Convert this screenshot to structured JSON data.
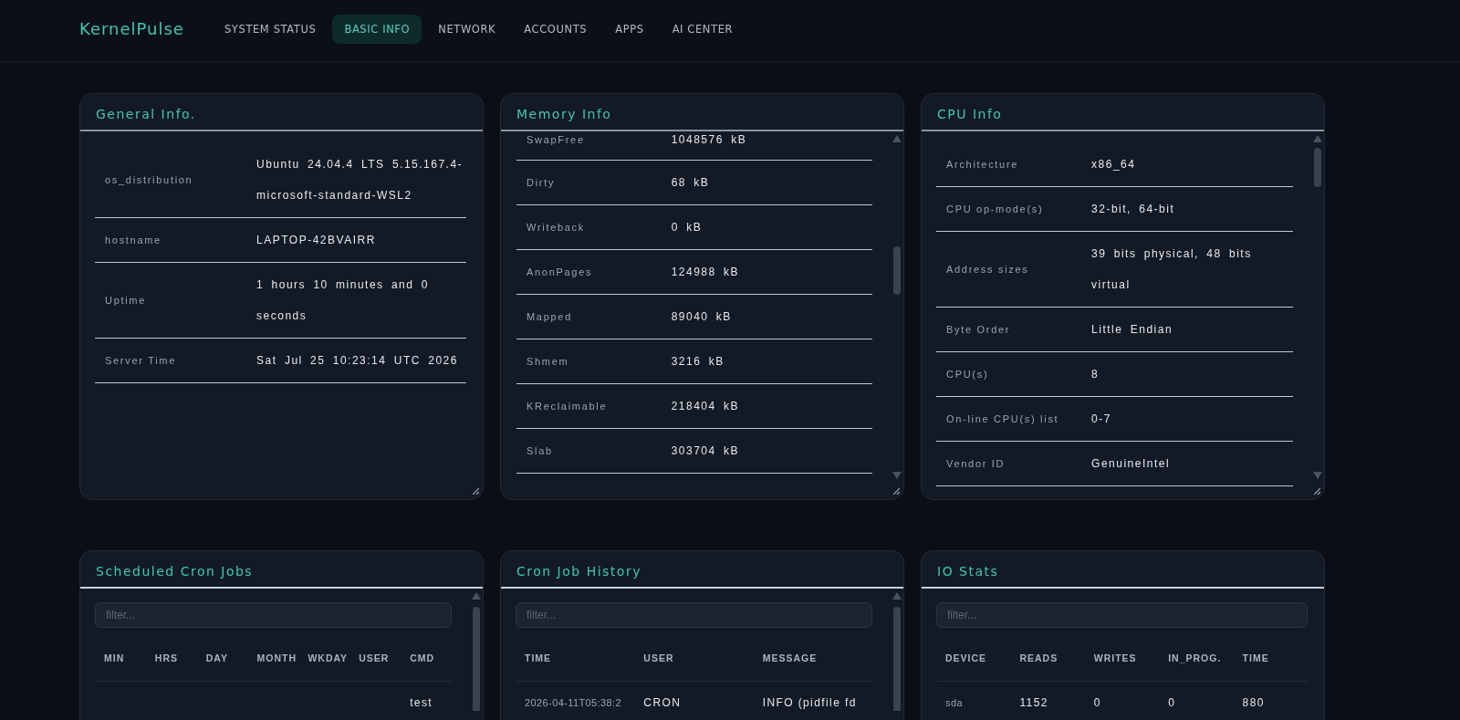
{
  "app": {
    "logo": "KernelPulse"
  },
  "nav": [
    {
      "label": "SYSTEM STATUS",
      "selected": false
    },
    {
      "label": "BASIC INFO",
      "selected": true
    },
    {
      "label": "NETWORK",
      "selected": false
    },
    {
      "label": "ACCOUNTS",
      "selected": false
    },
    {
      "label": "APPS",
      "selected": false
    },
    {
      "label": "AI CENTER",
      "selected": false
    }
  ],
  "panels": [
    {
      "kind": "kv",
      "title": "General Info.",
      "rows": [
        {
          "label": "os_distribution",
          "value": "Ubuntu 24.04.4 LTS 5.15.167.4-microsoft-standard-WSL2"
        },
        {
          "label": "hostname",
          "value": "LAPTOP-42BVAIRR"
        },
        {
          "label": "Uptime",
          "value": "1 hours 10 minutes and 0 seconds"
        },
        {
          "label": "Server Time",
          "value": "Sat Jul 25 10:23:14 UTC 2026"
        }
      ]
    },
    {
      "kind": "kv",
      "title": "Memory Info",
      "rows": [
        {
          "label": "SwapFree",
          "value": "1048576 kB"
        },
        {
          "label": "Dirty",
          "value": "68 kB"
        },
        {
          "label": "Writeback",
          "value": "0 kB"
        },
        {
          "label": "AnonPages",
          "value": "124988 kB"
        },
        {
          "label": "Mapped",
          "value": "89040 kB"
        },
        {
          "label": "Shmem",
          "value": "3216 kB"
        },
        {
          "label": "KReclaimable",
          "value": "218404 kB"
        },
        {
          "label": "Slab",
          "value": "303704 kB"
        }
      ]
    },
    {
      "kind": "kv",
      "title": "CPU Info",
      "rows": [
        {
          "label": "Architecture",
          "value": "x86_64"
        },
        {
          "label": "CPU op-mode(s)",
          "value": "32-bit, 64-bit"
        },
        {
          "label": "Address sizes",
          "value": "39 bits physical, 48 bits virtual"
        },
        {
          "label": "Byte Order",
          "value": "Little Endian"
        },
        {
          "label": "CPU(s)",
          "value": "8"
        },
        {
          "label": "On-line CPU(s) list",
          "value": "0-7"
        },
        {
          "label": "Vendor ID",
          "value": "GenuineIntel"
        }
      ]
    },
    {
      "kind": "table",
      "title": "Scheduled Cron Jobs",
      "filter": {
        "placeholder": "filter..."
      },
      "columns": [
        "MIN",
        "HRS",
        "DAY",
        "MONTH",
        "WKDAY",
        "USER",
        "CMD"
      ],
      "rows": [
        [
          null,
          null,
          null,
          null,
          null,
          null,
          "test"
        ]
      ]
    },
    {
      "kind": "table",
      "title": "Cron Job History",
      "filter": {
        "placeholder": "filter..."
      },
      "columns": [
        "TIME",
        "USER",
        "MESSAGE"
      ],
      "rows": [
        [
          "2026-04-11T05:38:2",
          "CRON",
          "INFO (pidfile fd"
        ]
      ]
    },
    {
      "kind": "table",
      "title": "IO Stats",
      "filter": {
        "placeholder": "filter..."
      },
      "columns": [
        "DEVICE",
        "READS",
        "WRITES",
        "IN_PROG.",
        "TIME"
      ],
      "rows": [
        [
          "sda",
          "1152",
          "0",
          "0",
          "880"
        ]
      ]
    }
  ]
}
